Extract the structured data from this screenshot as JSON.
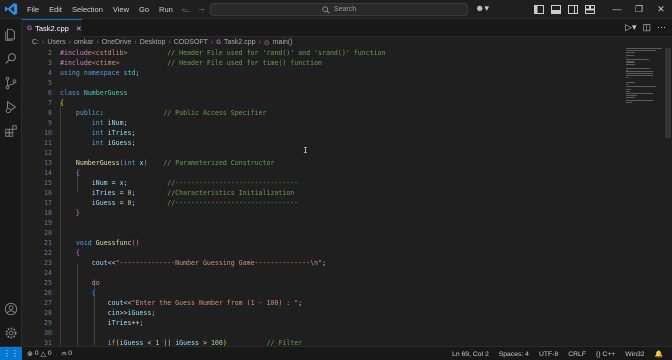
{
  "titlebar": {
    "menu": [
      "File",
      "Edit",
      "Selection",
      "View",
      "Go",
      "Run",
      "…"
    ],
    "search_placeholder": "Search"
  },
  "tab": {
    "filename": "Task2.cpp",
    "lang_badge": "G"
  },
  "breadcrumb": [
    "C:",
    "Users",
    "omkar",
    "OneDrive",
    "Desktop",
    "CODSOFT",
    "Task2.cpp",
    "main()"
  ],
  "editor": {
    "lines": [
      {
        "n": "2",
        "parts": [
          [
            "pp",
            "#include"
          ],
          [
            "inc",
            "<cstdlib>"
          ],
          [
            "pl",
            "          "
          ],
          [
            "cm",
            "// Header File used for 'rand()' and 'srand()' function"
          ]
        ]
      },
      {
        "n": "3",
        "parts": [
          [
            "pp",
            "#include"
          ],
          [
            "inc",
            "<ctime>"
          ],
          [
            "pl",
            "            "
          ],
          [
            "cm",
            "// Header File used for time() function"
          ]
        ]
      },
      {
        "n": "4",
        "parts": [
          [
            "kw",
            "using"
          ],
          [
            "pl",
            " "
          ],
          [
            "kw",
            "namespace"
          ],
          [
            "pl",
            " "
          ],
          [
            "ty",
            "std"
          ],
          [
            "pl",
            ";"
          ]
        ]
      },
      {
        "n": "5",
        "parts": []
      },
      {
        "n": "6",
        "parts": [
          [
            "kw",
            "class"
          ],
          [
            "pl",
            " "
          ],
          [
            "ty",
            "NumberGuess"
          ]
        ]
      },
      {
        "n": "7",
        "parts": [
          [
            "br1",
            "{"
          ]
        ]
      },
      {
        "n": "8",
        "parts": [
          [
            "pl",
            "    "
          ],
          [
            "kw",
            "public"
          ],
          [
            "pl",
            ":               "
          ],
          [
            "cm",
            "// Public Access Specifier"
          ]
        ]
      },
      {
        "n": "9",
        "parts": [
          [
            "pl",
            "        "
          ],
          [
            "kw",
            "int"
          ],
          [
            "pl",
            " "
          ],
          [
            "va",
            "iNum"
          ],
          [
            "pl",
            ";"
          ]
        ]
      },
      {
        "n": "10",
        "parts": [
          [
            "pl",
            "        "
          ],
          [
            "kw",
            "int"
          ],
          [
            "pl",
            " "
          ],
          [
            "va",
            "iTries"
          ],
          [
            "pl",
            ";"
          ]
        ]
      },
      {
        "n": "11",
        "parts": [
          [
            "pl",
            "        "
          ],
          [
            "kw",
            "int"
          ],
          [
            "pl",
            " "
          ],
          [
            "va",
            "iGuess"
          ],
          [
            "pl",
            ";"
          ]
        ]
      },
      {
        "n": "12",
        "parts": []
      },
      {
        "n": "13",
        "parts": [
          [
            "pl",
            "    "
          ],
          [
            "fn2",
            "NumberGuess"
          ],
          [
            "br2",
            "("
          ],
          [
            "kw",
            "int"
          ],
          [
            "pl",
            " "
          ],
          [
            "va",
            "x"
          ],
          [
            "br2",
            ")"
          ],
          [
            "pl",
            "    "
          ],
          [
            "cm",
            "// Parameterized Constructor"
          ]
        ]
      },
      {
        "n": "14",
        "parts": [
          [
            "pl",
            "    "
          ],
          [
            "br2",
            "{"
          ]
        ]
      },
      {
        "n": "15",
        "parts": [
          [
            "pl",
            "        "
          ],
          [
            "va",
            "iNum"
          ],
          [
            "pl",
            " = "
          ],
          [
            "va",
            "x"
          ],
          [
            "pl",
            ";          "
          ],
          [
            "cm",
            "//-------------------------------"
          ]
        ]
      },
      {
        "n": "16",
        "parts": [
          [
            "pl",
            "        "
          ],
          [
            "va",
            "iTries"
          ],
          [
            "pl",
            " = "
          ],
          [
            "nu",
            "0"
          ],
          [
            "pl",
            ";        "
          ],
          [
            "cm",
            "//Characteristics Initialization"
          ]
        ]
      },
      {
        "n": "17",
        "parts": [
          [
            "pl",
            "        "
          ],
          [
            "va",
            "iGuess"
          ],
          [
            "pl",
            " = "
          ],
          [
            "nu",
            "0"
          ],
          [
            "pl",
            ";        "
          ],
          [
            "cm",
            "//-------------------------------"
          ]
        ]
      },
      {
        "n": "18",
        "parts": [
          [
            "pl",
            "    "
          ],
          [
            "br2",
            "}"
          ]
        ]
      },
      {
        "n": "19",
        "parts": []
      },
      {
        "n": "20",
        "parts": []
      },
      {
        "n": "21",
        "parts": [
          [
            "pl",
            "    "
          ],
          [
            "kw",
            "void"
          ],
          [
            "pl",
            " "
          ],
          [
            "fn2",
            "Guessfunc"
          ],
          [
            "br2",
            "()"
          ]
        ]
      },
      {
        "n": "22",
        "parts": [
          [
            "pl",
            "    "
          ],
          [
            "br2",
            "{"
          ]
        ]
      },
      {
        "n": "23",
        "parts": [
          [
            "pl",
            "        "
          ],
          [
            "va",
            "cout"
          ],
          [
            "pl",
            "<<"
          ],
          [
            "st",
            "\"--------------Number Guessing Game--------------\\n\""
          ],
          [
            "pl",
            ";"
          ]
        ]
      },
      {
        "n": "24",
        "parts": []
      },
      {
        "n": "25",
        "parts": [
          [
            "pl",
            "        "
          ],
          [
            "ctl",
            "do"
          ]
        ]
      },
      {
        "n": "26",
        "parts": [
          [
            "pl",
            "        "
          ],
          [
            "br3",
            "{"
          ]
        ]
      },
      {
        "n": "27",
        "parts": [
          [
            "pl",
            "            "
          ],
          [
            "va",
            "cout"
          ],
          [
            "pl",
            "<<"
          ],
          [
            "st",
            "\"Enter the Guess Number from (1 - 100) : \""
          ],
          [
            "pl",
            ";"
          ]
        ]
      },
      {
        "n": "28",
        "parts": [
          [
            "pl",
            "            "
          ],
          [
            "va",
            "cin"
          ],
          [
            "pl",
            ">>"
          ],
          [
            "va",
            "iGuess"
          ],
          [
            "pl",
            ";"
          ]
        ]
      },
      {
        "n": "29",
        "parts": [
          [
            "pl",
            "            "
          ],
          [
            "va",
            "iTries"
          ],
          [
            "pl",
            "++;"
          ]
        ]
      },
      {
        "n": "30",
        "parts": []
      },
      {
        "n": "31",
        "parts": [
          [
            "pl",
            "            "
          ],
          [
            "ctl",
            "if"
          ],
          [
            "br1",
            "("
          ],
          [
            "va",
            "iGuess"
          ],
          [
            "pl",
            " < "
          ],
          [
            "nu",
            "1"
          ],
          [
            "pl",
            " || "
          ],
          [
            "va",
            "iGuess"
          ],
          [
            "pl",
            " > "
          ],
          [
            "nu",
            "100"
          ],
          [
            "br1",
            ")"
          ],
          [
            "pl",
            "          "
          ],
          [
            "cm",
            "// Filter"
          ]
        ]
      },
      {
        "n": "32",
        "parts": [
          [
            "pl",
            "            "
          ],
          [
            "br1",
            "{"
          ]
        ]
      }
    ]
  },
  "statusbar": {
    "errors": "0",
    "warnings": "0",
    "ports": "0",
    "position": "Ln 69, Col 2",
    "spaces": "Spaces: 4",
    "encoding": "UTF-8",
    "eol": "CRLF",
    "language": "{} C++",
    "platform": "Win32"
  }
}
